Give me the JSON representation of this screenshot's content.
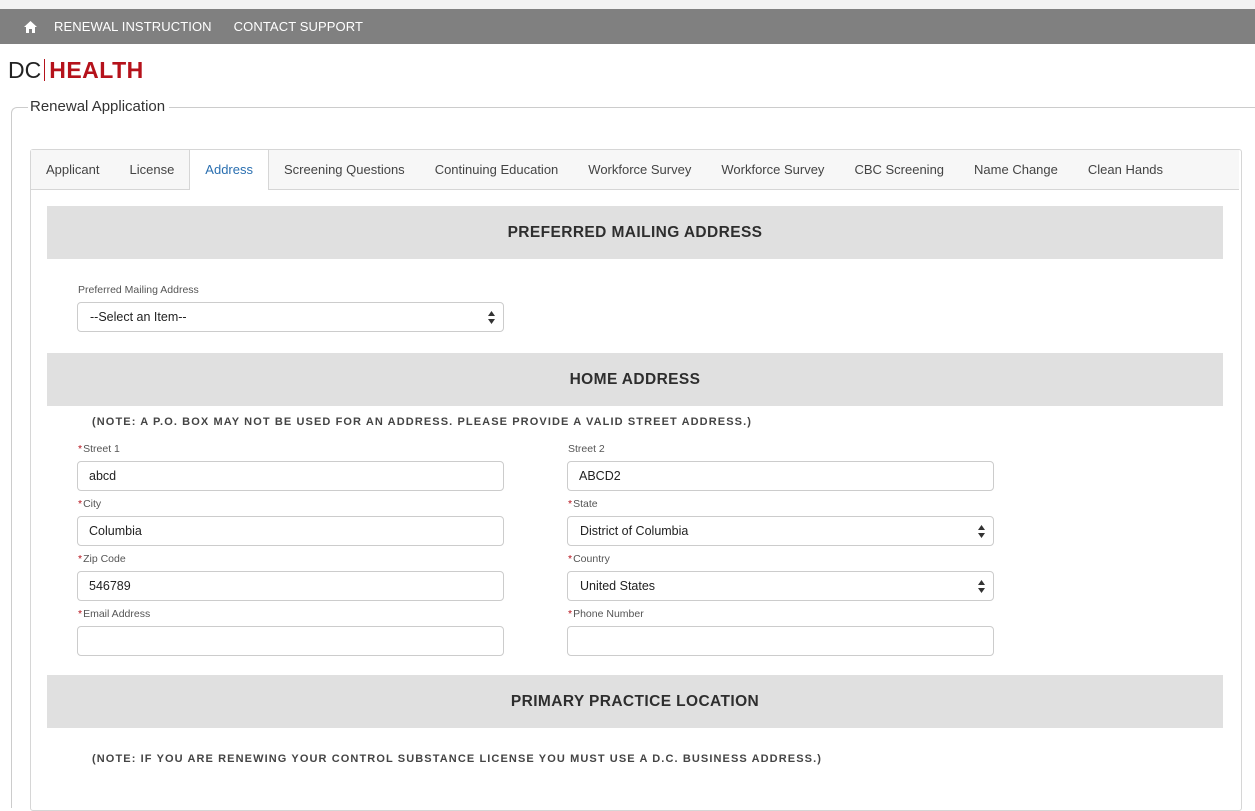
{
  "topnav": {
    "home_icon": "home-icon",
    "links": [
      "RENEWAL INSTRUCTION",
      "CONTACT SUPPORT"
    ]
  },
  "logo": {
    "part1": "DC",
    "part2": "HEALTH"
  },
  "section_title": "Renewal Application",
  "tabs": [
    {
      "label": "Applicant"
    },
    {
      "label": "License"
    },
    {
      "label": "Address",
      "active": true
    },
    {
      "label": "Screening Questions"
    },
    {
      "label": "Continuing Education"
    },
    {
      "label": "Workforce Survey"
    },
    {
      "label": "Workforce Survey"
    },
    {
      "label": "CBC Screening"
    },
    {
      "label": "Name Change"
    },
    {
      "label": "Clean Hands"
    }
  ],
  "preferred": {
    "header": "PREFERRED MAILING ADDRESS",
    "field_label": "Preferred Mailing Address",
    "value": "--Select an Item--"
  },
  "home": {
    "header": "HOME ADDRESS",
    "note": "(NOTE: A P.O. BOX MAY NOT BE USED FOR AN ADDRESS. PLEASE PROVIDE A VALID STREET ADDRESS.)",
    "street1": {
      "label": "Street 1",
      "value": "abcd"
    },
    "street2": {
      "label": "Street 2",
      "value": "ABCD2"
    },
    "city": {
      "label": "City",
      "value": "Columbia"
    },
    "state": {
      "label": "State",
      "value": "District of Columbia"
    },
    "zip": {
      "label": "Zip Code",
      "value": "546789"
    },
    "country": {
      "label": "Country",
      "value": "United States"
    },
    "email": {
      "label": "Email Address",
      "value": ""
    },
    "phone": {
      "label": "Phone Number",
      "value": ""
    }
  },
  "practice": {
    "header": "PRIMARY PRACTICE LOCATION",
    "note": "(NOTE: IF YOU ARE RENEWING YOUR CONTROL SUBSTANCE LICENSE YOU MUST USE A D.C. BUSINESS ADDRESS.)"
  },
  "required_marker": "*",
  "colors": {
    "brand_red": "#b5121b",
    "nav_bg": "#808080",
    "active_tab": "#2a6fb0",
    "band_bg": "#e0e0e0"
  }
}
